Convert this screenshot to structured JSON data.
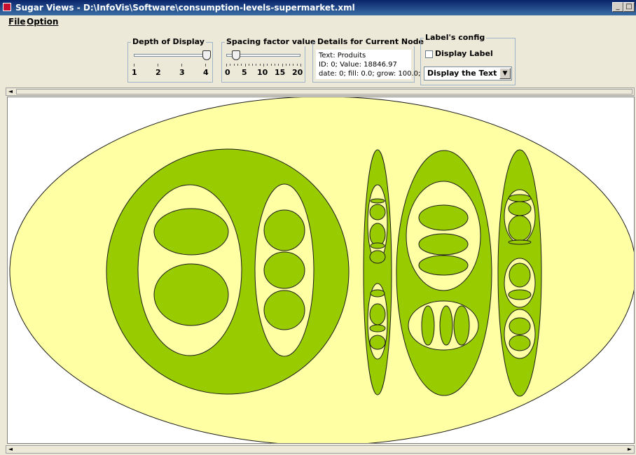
{
  "window": {
    "title": "Sugar Views - D:\\InfoVis\\Software\\consumption-levels-supermarket.xml",
    "minimize_label": "_",
    "maximize_label": "□"
  },
  "menu": {
    "items": [
      {
        "label": "File"
      },
      {
        "label": "Option"
      }
    ]
  },
  "depth_panel": {
    "title": "Depth of Display",
    "ticks": [
      "1",
      "2",
      "3",
      "4"
    ],
    "value_fraction": 1.0
  },
  "spacing_panel": {
    "title": "Spacing factor value",
    "ticks": [
      "0",
      "5",
      "10",
      "15",
      "20"
    ],
    "value_fraction": 0.13
  },
  "details_panel": {
    "title": "Details for Current Node",
    "line1": "Text: Produits",
    "line2": "ID: 0; Value: 18846.97",
    "line3": "date: 0; fill: 0.0; grow: 100.0;"
  },
  "label_panel": {
    "title": "Label's config",
    "display_label_text": "Display Label",
    "display_label_checked": false,
    "combo_value": "Display the Text",
    "combo_arrow": "▼"
  },
  "scroll": {
    "left_arrow": "◄",
    "right_arrow": "►"
  },
  "colors": {
    "background_level": "#ffffa4",
    "green_level": "#99cc00",
    "stroke": "#1a1a1a"
  }
}
